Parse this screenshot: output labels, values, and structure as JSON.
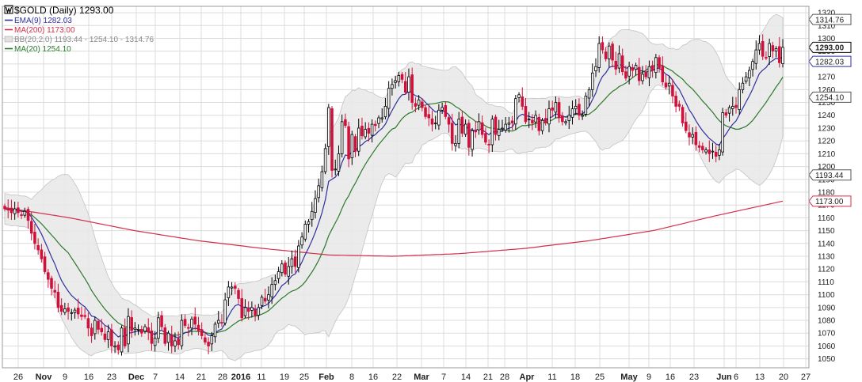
{
  "chart_data": {
    "type": "candlestick",
    "title": "$GOLD (Daily) 1293.00",
    "legend": [
      {
        "label": "EMA(9) 1282.03",
        "color": "#2f2fa0"
      },
      {
        "label": "MA(200) 1173.00",
        "color": "#d42f4a"
      },
      {
        "label": "BB(20,2.0) 1193.44 - 1254.10 - 1314.76",
        "color": "#8a8a8a"
      },
      {
        "label": "MA(20) 1254.10",
        "color": "#2a7a2a"
      }
    ],
    "y_ticks": [
      1050,
      1060,
      1070,
      1080,
      1090,
      1100,
      1110,
      1120,
      1130,
      1140,
      1150,
      1160,
      1170,
      1180,
      1190,
      1200,
      1210,
      1220,
      1230,
      1240,
      1250,
      1260,
      1270,
      1280,
      1290,
      1300,
      1310,
      1320
    ],
    "ylim": [
      1043,
      1325
    ],
    "x_labels": [
      "26",
      "Nov",
      "9",
      "16",
      "23",
      "Dec",
      "7",
      "14",
      "21",
      "28",
      "2016",
      "11",
      "19",
      "25",
      "Feb",
      "8",
      "16",
      "22",
      "Mar",
      "7",
      "14",
      "21",
      "28",
      "Apr",
      "11",
      "18",
      "25",
      "May",
      "9",
      "16",
      "23",
      "Jun",
      "6",
      "13",
      "20",
      "27"
    ],
    "price_tags": [
      {
        "label": "1314.76",
        "value": 1314.76,
        "style": "plain"
      },
      {
        "label": "1293.00",
        "value": 1293.0,
        "style": "bold"
      },
      {
        "label": "1282.03",
        "value": 1282.03,
        "style": "blue"
      },
      {
        "label": "1254.10",
        "value": 1254.1,
        "style": "plain"
      },
      {
        "label": "1193.44",
        "value": 1193.44,
        "style": "plain"
      },
      {
        "label": "1173.00",
        "value": 1173.0,
        "style": "red"
      }
    ],
    "closes": [
      1167,
      1166,
      1164,
      1167,
      1164,
      1162,
      1165,
      1158,
      1148,
      1140,
      1135,
      1128,
      1118,
      1112,
      1105,
      1102,
      1090,
      1087,
      1089,
      1087,
      1086,
      1088,
      1085,
      1083,
      1083,
      1074,
      1068,
      1080,
      1073,
      1071,
      1065,
      1071,
      1060,
      1060,
      1057,
      1074,
      1060,
      1083,
      1072,
      1074,
      1073,
      1070,
      1075,
      1071,
      1062,
      1066,
      1082,
      1075,
      1062,
      1070,
      1060,
      1064,
      1061,
      1080,
      1076,
      1074,
      1081,
      1077,
      1072,
      1068,
      1063,
      1060,
      1068,
      1077,
      1080,
      1078,
      1096,
      1106,
      1106,
      1105,
      1097,
      1082,
      1090,
      1087,
      1090,
      1084,
      1090,
      1098,
      1095,
      1100,
      1108,
      1111,
      1118,
      1124,
      1116,
      1122,
      1128,
      1122,
      1138,
      1145,
      1155,
      1157,
      1165,
      1175,
      1185,
      1196,
      1214,
      1246,
      1197,
      1198,
      1210,
      1235,
      1232,
      1206,
      1225,
      1212,
      1230,
      1224,
      1229,
      1226,
      1233,
      1232,
      1238,
      1238,
      1247,
      1261,
      1264,
      1267,
      1271,
      1268,
      1258,
      1270,
      1250,
      1247,
      1252,
      1246,
      1239,
      1238,
      1233,
      1234,
      1244,
      1246,
      1239,
      1233,
      1218,
      1218,
      1237,
      1226,
      1233,
      1215,
      1228,
      1227,
      1235,
      1225,
      1219,
      1217,
      1237,
      1225,
      1229,
      1230,
      1233,
      1234,
      1234,
      1253,
      1256,
      1247,
      1235,
      1237,
      1234,
      1240,
      1228,
      1236,
      1234,
      1245,
      1244,
      1250,
      1238,
      1235,
      1235,
      1240,
      1245,
      1247,
      1240,
      1240,
      1255,
      1260,
      1273,
      1278,
      1296,
      1291,
      1284,
      1294,
      1283,
      1276,
      1288,
      1274,
      1269,
      1278,
      1275,
      1279,
      1267,
      1272,
      1270,
      1278,
      1275,
      1285,
      1277,
      1266,
      1262,
      1265,
      1255,
      1247,
      1247,
      1234,
      1228,
      1223,
      1225,
      1217,
      1215,
      1213,
      1213,
      1210,
      1212,
      1208,
      1213,
      1242,
      1240,
      1246,
      1247,
      1246,
      1260,
      1265,
      1270,
      1275,
      1282,
      1291,
      1296,
      1286,
      1285,
      1296,
      1290,
      1292,
      1281,
      1293
    ],
    "ema9_last": 1282.03,
    "ma20_last": 1254.1,
    "ma200_last": 1173.0,
    "bb_upper_last": 1314.76,
    "bb_lower_last": 1193.44
  }
}
